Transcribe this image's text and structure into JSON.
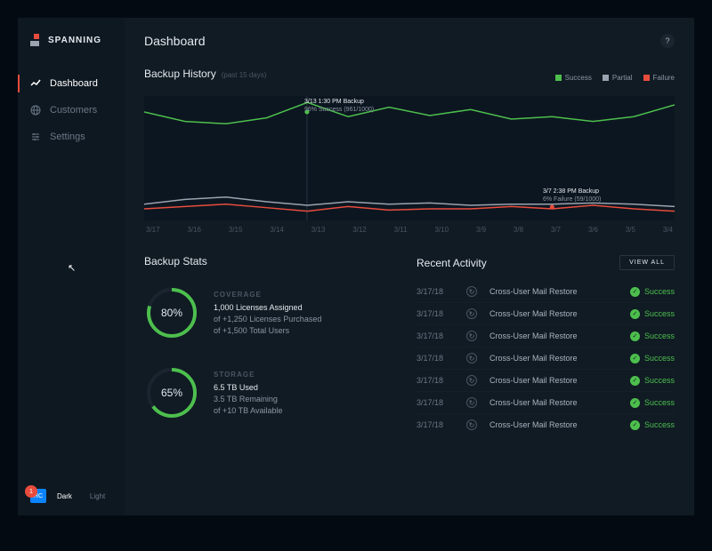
{
  "brand": "SPANNING",
  "page_title": "Dashboard",
  "nav": [
    {
      "label": "Dashboard",
      "active": true,
      "icon": "trend"
    },
    {
      "label": "Customers",
      "active": false,
      "icon": "globe"
    },
    {
      "label": "Settings",
      "active": false,
      "icon": "sliders"
    }
  ],
  "theme": {
    "rc": "RC",
    "notif": "1",
    "options": [
      "Dark",
      "Light"
    ],
    "active": "Dark"
  },
  "backup_history": {
    "title": "Backup History",
    "subtitle": "(past 15 days)",
    "legend": [
      {
        "label": "Success",
        "color": "#4dbf4d"
      },
      {
        "label": "Partial",
        "color": "#9aa3af"
      },
      {
        "label": "Failure",
        "color": "#e84c3d"
      }
    ],
    "x_ticks": [
      "3/17",
      "3/16",
      "3/15",
      "3/14",
      "3/13",
      "3/12",
      "3/11",
      "3/10",
      "3/9",
      "3/8",
      "3/7",
      "3/6",
      "3/5",
      "3/4"
    ],
    "tooltip1": {
      "line1": "3/13 1:30 PM Backup",
      "line2": "96% Success (961/1000)"
    },
    "tooltip2": {
      "line1": "3/7 2:38 PM Backup",
      "line2": "6% Failure (59/1000)"
    }
  },
  "chart_data": {
    "type": "line",
    "title": "Backup History (past 15 days)",
    "xlabel": "",
    "ylabel": "",
    "categories": [
      "3/17",
      "3/16",
      "3/15",
      "3/14",
      "3/13",
      "3/12",
      "3/11",
      "3/10",
      "3/9",
      "3/8",
      "3/7",
      "3/6",
      "3/5",
      "3/4"
    ],
    "series": [
      {
        "name": "Success",
        "color": "#4dbf4d",
        "values": [
          88,
          80,
          78,
          83,
          96,
          84,
          92,
          85,
          90,
          82,
          84,
          80,
          84,
          94
        ]
      },
      {
        "name": "Partial",
        "color": "#9aa3af",
        "values": [
          10,
          14,
          16,
          12,
          9,
          12,
          10,
          11,
          9,
          10,
          10,
          11,
          10,
          8
        ]
      },
      {
        "name": "Failure",
        "color": "#e84c3d",
        "values": [
          6,
          8,
          10,
          7,
          4,
          8,
          5,
          6,
          6,
          8,
          6,
          9,
          6,
          4
        ]
      }
    ],
    "ylim": [
      0,
      100
    ]
  },
  "stats": {
    "title": "Backup Stats",
    "coverage": {
      "label": "COVERAGE",
      "pct": "80%",
      "value": 80,
      "line1": "1,000 Licenses Assigned",
      "line2": "of +1,250 Licenses Purchased",
      "line3": "of +1,500 Total Users"
    },
    "storage": {
      "label": "STORAGE",
      "pct": "65%",
      "value": 65,
      "line1": "6.5 TB Used",
      "line2": "3.5 TB Remaining",
      "line3": "of +10 TB Available"
    }
  },
  "activity": {
    "title": "Recent Activity",
    "view_all": "VIEW ALL",
    "status_label": "Success",
    "rows": [
      {
        "date": "3/17/18",
        "desc": "Cross-User Mail Restore"
      },
      {
        "date": "3/17/18",
        "desc": "Cross-User Mail Restore"
      },
      {
        "date": "3/17/18",
        "desc": "Cross-User Mail Restore"
      },
      {
        "date": "3/17/18",
        "desc": "Cross-User Mail Restore"
      },
      {
        "date": "3/17/18",
        "desc": "Cross-User Mail Restore"
      },
      {
        "date": "3/17/18",
        "desc": "Cross-User Mail Restore"
      },
      {
        "date": "3/17/18",
        "desc": "Cross-User Mail Restore"
      }
    ]
  }
}
